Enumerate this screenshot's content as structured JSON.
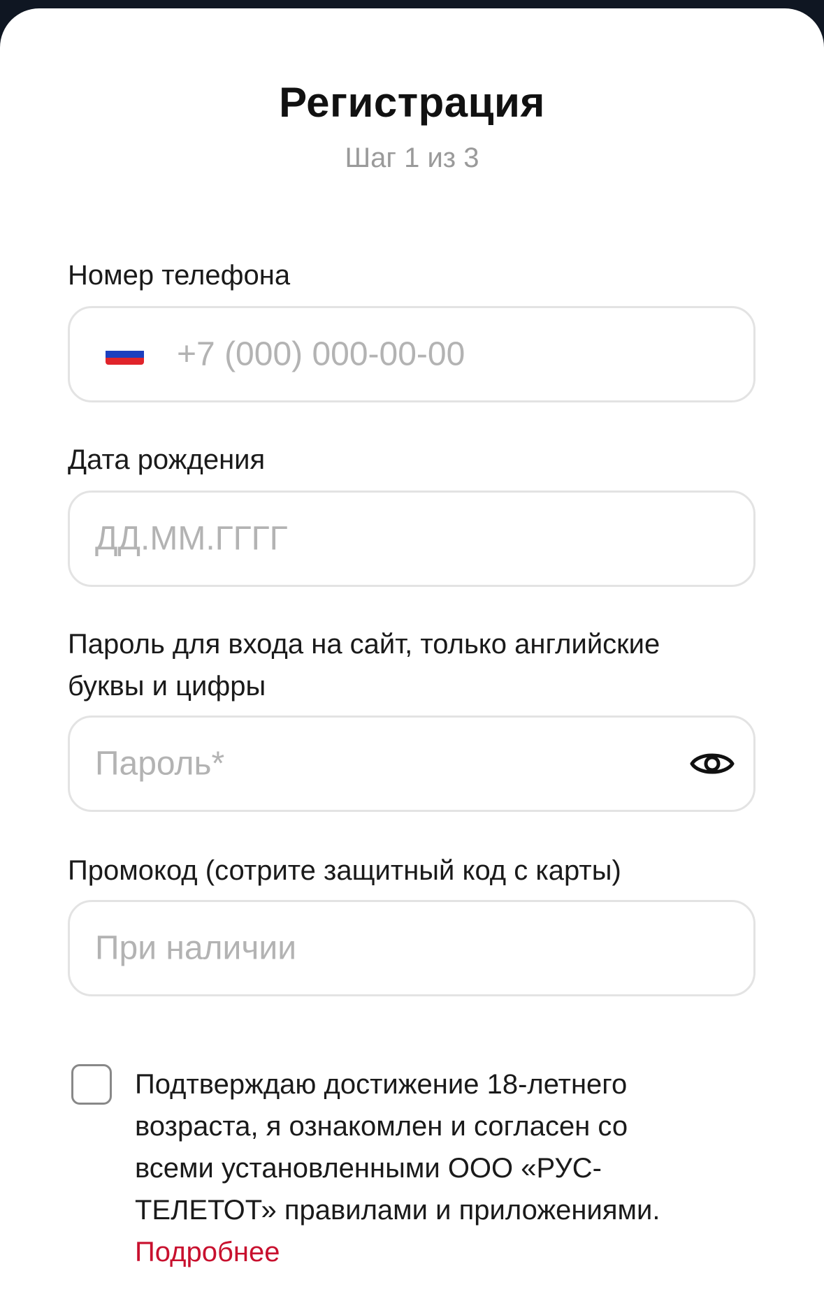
{
  "header": {
    "title": "Регистрация",
    "step": "Шаг 1 из 3"
  },
  "phone": {
    "label": "Номер телефона",
    "placeholder": "+7 (000) 000-00-00",
    "flag_icon": "russia-flag-icon",
    "flag_colors": [
      "#ffffff",
      "#1c3fbf",
      "#e0242b"
    ]
  },
  "birthdate": {
    "label": "Дата рождения",
    "placeholder": "ДД.ММ.ГГГГ"
  },
  "password": {
    "label_line1": "Пароль для входа на сайт, только английские",
    "label_line2": "буквы и цифры",
    "placeholder": "Пароль*",
    "toggle_icon": "eye-icon"
  },
  "promo": {
    "label": "Промокод (сотрите защитный код с карты)",
    "placeholder": "При наличии"
  },
  "consent": {
    "checked": false,
    "line1": "Подтверждаю достижение 18-летнего",
    "line2": "возраста, я ознакомлен и согласен со",
    "line3": "всеми установленными ООО «РУС-",
    "line4": "ТЕЛЕТОТ» правилами и приложениями.",
    "more_link": "Подробнее",
    "link_color": "#c8102e"
  }
}
